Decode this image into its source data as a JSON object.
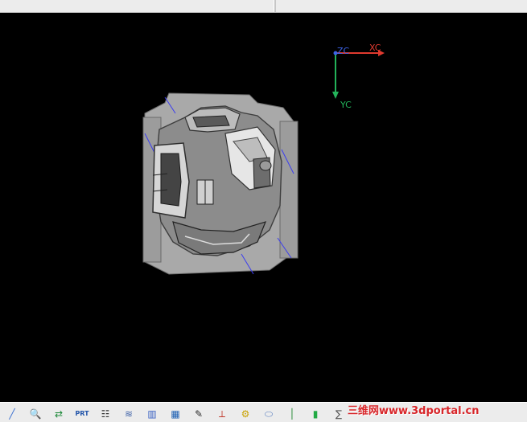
{
  "view": {
    "triad": {
      "zc": "ZC",
      "xc": "XC",
      "yc": "YC"
    }
  },
  "toolbar": {
    "tools": [
      {
        "name": "sketch-tool-icon",
        "glyph": "╱"
      },
      {
        "name": "search-tool-icon",
        "glyph": "🔍"
      },
      {
        "name": "flow-tool-icon",
        "glyph": "⇄"
      },
      {
        "name": "prt-tool-icon",
        "glyph": "PRT"
      },
      {
        "name": "tree-tool-icon",
        "glyph": "☷"
      },
      {
        "name": "layers-tool-icon",
        "glyph": "≋"
      },
      {
        "name": "book-tool-icon",
        "glyph": "▥"
      },
      {
        "name": "table-tool-icon",
        "glyph": "▦"
      },
      {
        "name": "pen-tool-icon",
        "glyph": "✎"
      },
      {
        "name": "csys-tool-icon",
        "glyph": "⟂"
      },
      {
        "name": "gear-tool-icon",
        "glyph": "⚙"
      },
      {
        "name": "cylinder-tool-icon",
        "glyph": "⬭"
      },
      {
        "name": "ruler-tool-icon",
        "glyph": "│"
      },
      {
        "name": "bar-tool-icon",
        "glyph": "▮"
      },
      {
        "name": "formula-tool-icon",
        "glyph": "∑"
      }
    ]
  },
  "watermark": "三维网www.3dportal.cn",
  "colors": {
    "xc": "#e03a2f",
    "yc": "#23b35a",
    "zc": "#3c63e6"
  }
}
